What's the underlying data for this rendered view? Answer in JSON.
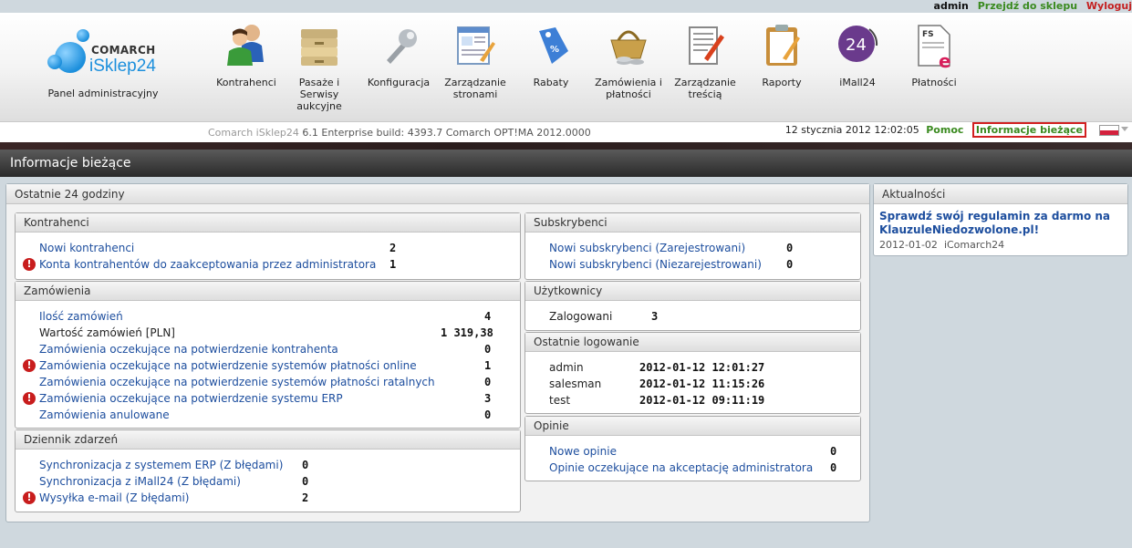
{
  "userbar": {
    "user": "admin",
    "shop_link": "Przejdź do sklepu",
    "logout": "Wyloguj"
  },
  "logo": {
    "brand": "COMARCH",
    "product": "iSklep24"
  },
  "panel_label": "Panel administracyjny",
  "nav": [
    {
      "label": "Kontrahenci",
      "icon": "contractors-icon"
    },
    {
      "label": "Pasaże i Serwisy aukcyjne",
      "icon": "folders-icon"
    },
    {
      "label": "Konfiguracja",
      "icon": "wrench-icon"
    },
    {
      "label": "Zarządzanie stronami",
      "icon": "page-edit-icon"
    },
    {
      "label": "Rabaty",
      "icon": "discount-tag-icon"
    },
    {
      "label": "Zamówienia i płatności",
      "icon": "basket-icon"
    },
    {
      "label": "Zarządzanie treścią",
      "icon": "content-edit-icon"
    },
    {
      "label": "Raporty",
      "icon": "clipboard-icon"
    },
    {
      "label": "iMall24",
      "icon": "imall24-icon"
    },
    {
      "label": "Płatności",
      "icon": "invoice-icon"
    }
  ],
  "subheader": {
    "build_muted": "Comarch iSklep24",
    "build": "6.1 Enterprise build: 4393.7  Comarch OPT!MA 2012.0000",
    "date": "12 stycznia 2012 12:02:05",
    "help": "Pomoc",
    "info": "Informacje bieżące"
  },
  "page_title": "Informacje bieżące",
  "main_panel_title": "Ostatnie 24 godziny",
  "kontrahenci": {
    "title": "Kontrahenci",
    "rows": [
      {
        "label": "Nowi kontrahenci",
        "value": "2",
        "warn": false
      },
      {
        "label": "Konta kontrahentów do zaakceptowania przez administratora",
        "value": "1",
        "warn": true
      }
    ]
  },
  "zamowienia": {
    "title": "Zamówienia",
    "rows": [
      {
        "label": "Ilość zamówień",
        "value": "4",
        "warn": false,
        "link": true
      },
      {
        "label": "Wartość zamówień [PLN]",
        "value": "1 319,38",
        "warn": false,
        "link": false
      },
      {
        "label": "Zamówienia oczekujące na potwierdzenie kontrahenta",
        "value": "0",
        "warn": false,
        "link": true
      },
      {
        "label": "Zamówienia oczekujące na potwierdzenie systemów płatności online",
        "value": "1",
        "warn": true,
        "link": true
      },
      {
        "label": "Zamówienia oczekujące na potwierdzenie systemów płatności ratalnych",
        "value": "0",
        "warn": false,
        "link": true
      },
      {
        "label": "Zamówienia oczekujące na potwierdzenie systemu ERP",
        "value": "3",
        "warn": true,
        "link": true
      },
      {
        "label": "Zamówienia anulowane",
        "value": "0",
        "warn": false,
        "link": true
      }
    ]
  },
  "dziennik": {
    "title": "Dziennik zdarzeń",
    "rows": [
      {
        "label": "Synchronizacja z systemem ERP (Z błędami)",
        "value": "0",
        "warn": false
      },
      {
        "label": "Synchronizacja z iMall24 (Z błędami)",
        "value": "0",
        "warn": false
      },
      {
        "label": "Wysyłka e-mail (Z błędami)",
        "value": "2",
        "warn": true
      }
    ]
  },
  "subskrybenci": {
    "title": "Subskrybenci",
    "rows": [
      {
        "label": "Nowi subskrybenci (Zarejestrowani)",
        "value": "0"
      },
      {
        "label": "Nowi subskrybenci (Niezarejestrowani)",
        "value": "0"
      }
    ]
  },
  "uzytkownicy": {
    "title": "Użytkownicy",
    "rows": [
      {
        "label": "Zalogowani",
        "value": "3"
      }
    ]
  },
  "logowanie": {
    "title": "Ostatnie logowanie",
    "rows": [
      {
        "label": "admin",
        "value": "2012-01-12 12:01:27"
      },
      {
        "label": "salesman",
        "value": "2012-01-12 11:15:26"
      },
      {
        "label": "test",
        "value": "2012-01-12 09:11:19"
      }
    ]
  },
  "opinie": {
    "title": "Opinie",
    "rows": [
      {
        "label": "Nowe opinie",
        "value": "0"
      },
      {
        "label": "Opinie oczekujące na akceptację administratora",
        "value": "0"
      }
    ]
  },
  "aktualnosci": {
    "title": "Aktualności",
    "news_title": "Sprawdź swój regulamin za darmo na KlauzuleNiedozwolone.pl!",
    "news_date": "2012-01-02",
    "news_author": "iComarch24"
  },
  "colors": {
    "link": "#1d4e9e",
    "green": "#3a8a1f",
    "red": "#c42020"
  }
}
